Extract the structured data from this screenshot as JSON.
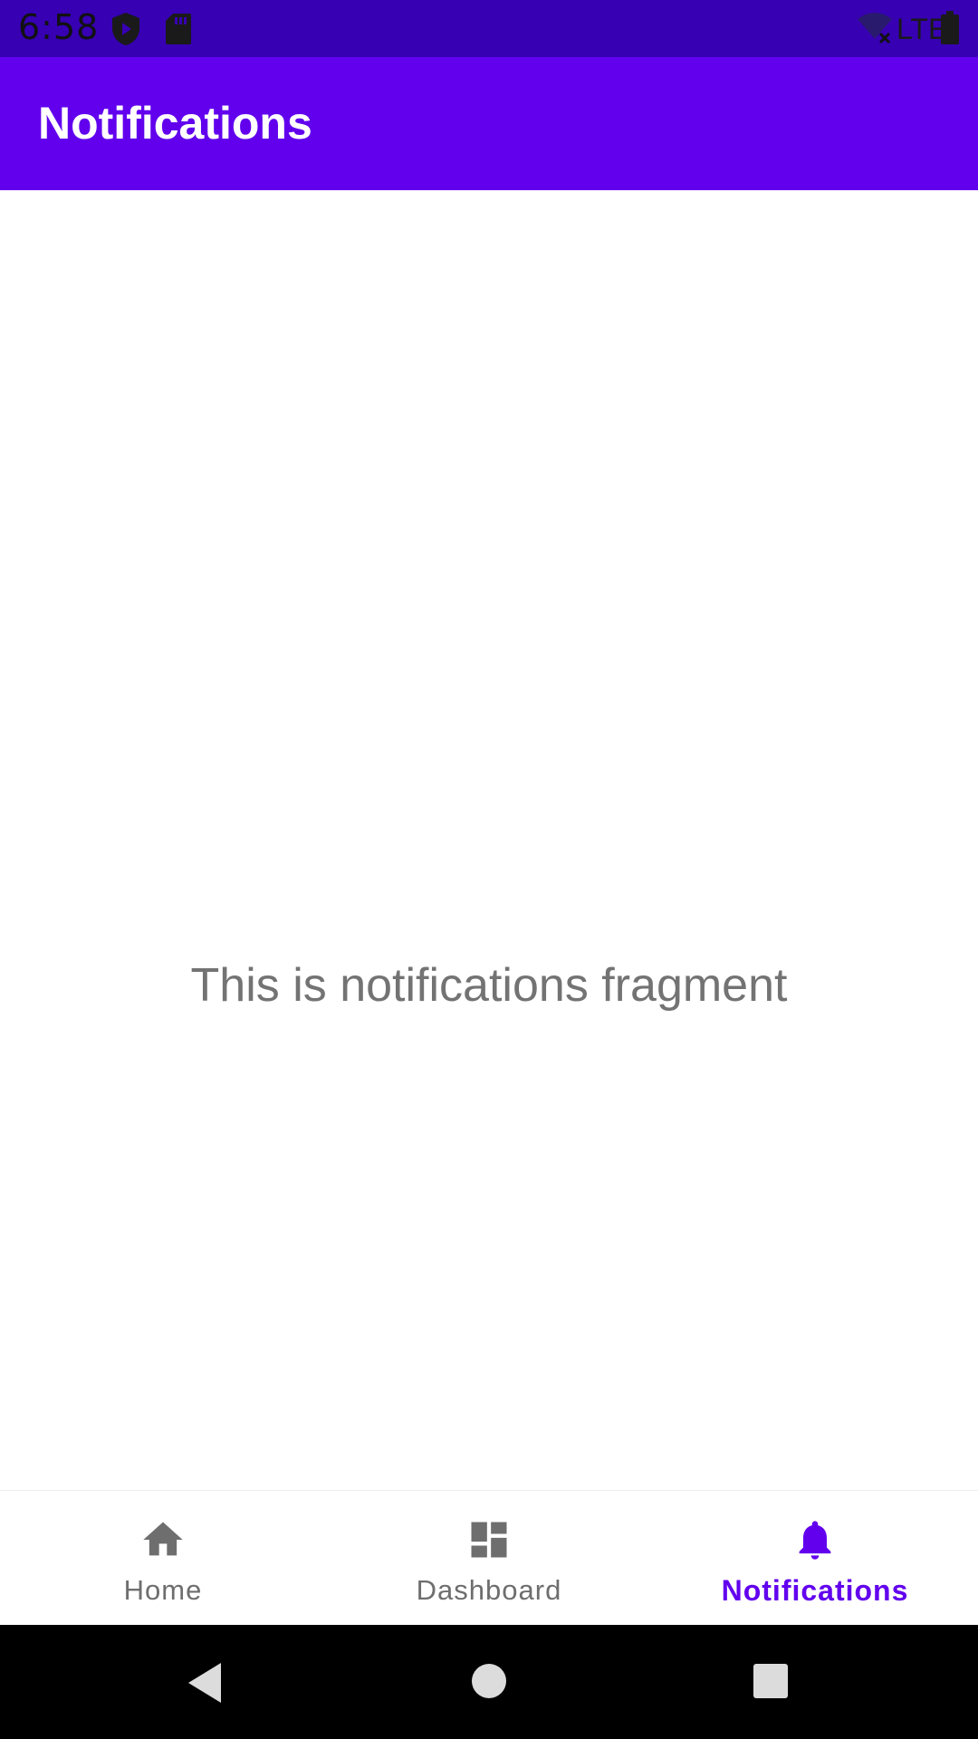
{
  "status_bar": {
    "time": "6:58",
    "icons": [
      "shield-icon",
      "sd-card-icon",
      "wifi-off-icon",
      "lte-icon",
      "battery-icon"
    ],
    "network_label": "LTE"
  },
  "app_bar": {
    "title": "Notifications"
  },
  "content": {
    "message": "This is notifications fragment"
  },
  "bottom_nav": {
    "items": [
      {
        "label": "Home",
        "icon": "home-icon",
        "active": false
      },
      {
        "label": "Dashboard",
        "icon": "dashboard-icon",
        "active": false
      },
      {
        "label": "Notifications",
        "icon": "bell-icon",
        "active": true
      }
    ]
  },
  "system_nav": {
    "buttons": [
      "back-icon",
      "home-circle-icon",
      "recents-square-icon"
    ]
  },
  "colors": {
    "primary": "#6200ee",
    "primary_dark": "#3700b3",
    "inactive": "#6e6e6e",
    "text_secondary": "#737373"
  }
}
